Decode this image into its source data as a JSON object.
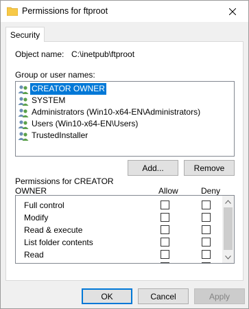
{
  "window": {
    "title": "Permissions for ftproot"
  },
  "tabs": [
    {
      "label": "Security"
    }
  ],
  "object": {
    "label": "Object name:",
    "value": "C:\\inetpub\\ftproot"
  },
  "group_section": {
    "label": "Group or user names:"
  },
  "users": [
    {
      "name": "CREATOR OWNER",
      "selected": true
    },
    {
      "name": "SYSTEM",
      "selected": false
    },
    {
      "name": "Administrators (Win10-x64-EN\\Administrators)",
      "selected": false
    },
    {
      "name": "Users (Win10-x64-EN\\Users)",
      "selected": false
    },
    {
      "name": "TrustedInstaller",
      "selected": false
    }
  ],
  "buttons": {
    "add": "Add...",
    "remove": "Remove",
    "ok": "OK",
    "cancel": "Cancel",
    "apply": "Apply"
  },
  "permissions": {
    "header_line1": "Permissions for CREATOR",
    "header_line2": "OWNER",
    "allow_label": "Allow",
    "deny_label": "Deny",
    "rows": [
      {
        "name": "Full control",
        "allow": false,
        "deny": false
      },
      {
        "name": "Modify",
        "allow": false,
        "deny": false
      },
      {
        "name": "Read & execute",
        "allow": false,
        "deny": false
      },
      {
        "name": "List folder contents",
        "allow": false,
        "deny": false
      },
      {
        "name": "Read",
        "allow": false,
        "deny": false
      }
    ]
  },
  "colors": {
    "selection": "#0078d7",
    "dialog_bg": "#f0f0f0",
    "folder": "#f7c948"
  },
  "icons": {
    "title": "folder-icon",
    "user": "user-group-icon"
  }
}
